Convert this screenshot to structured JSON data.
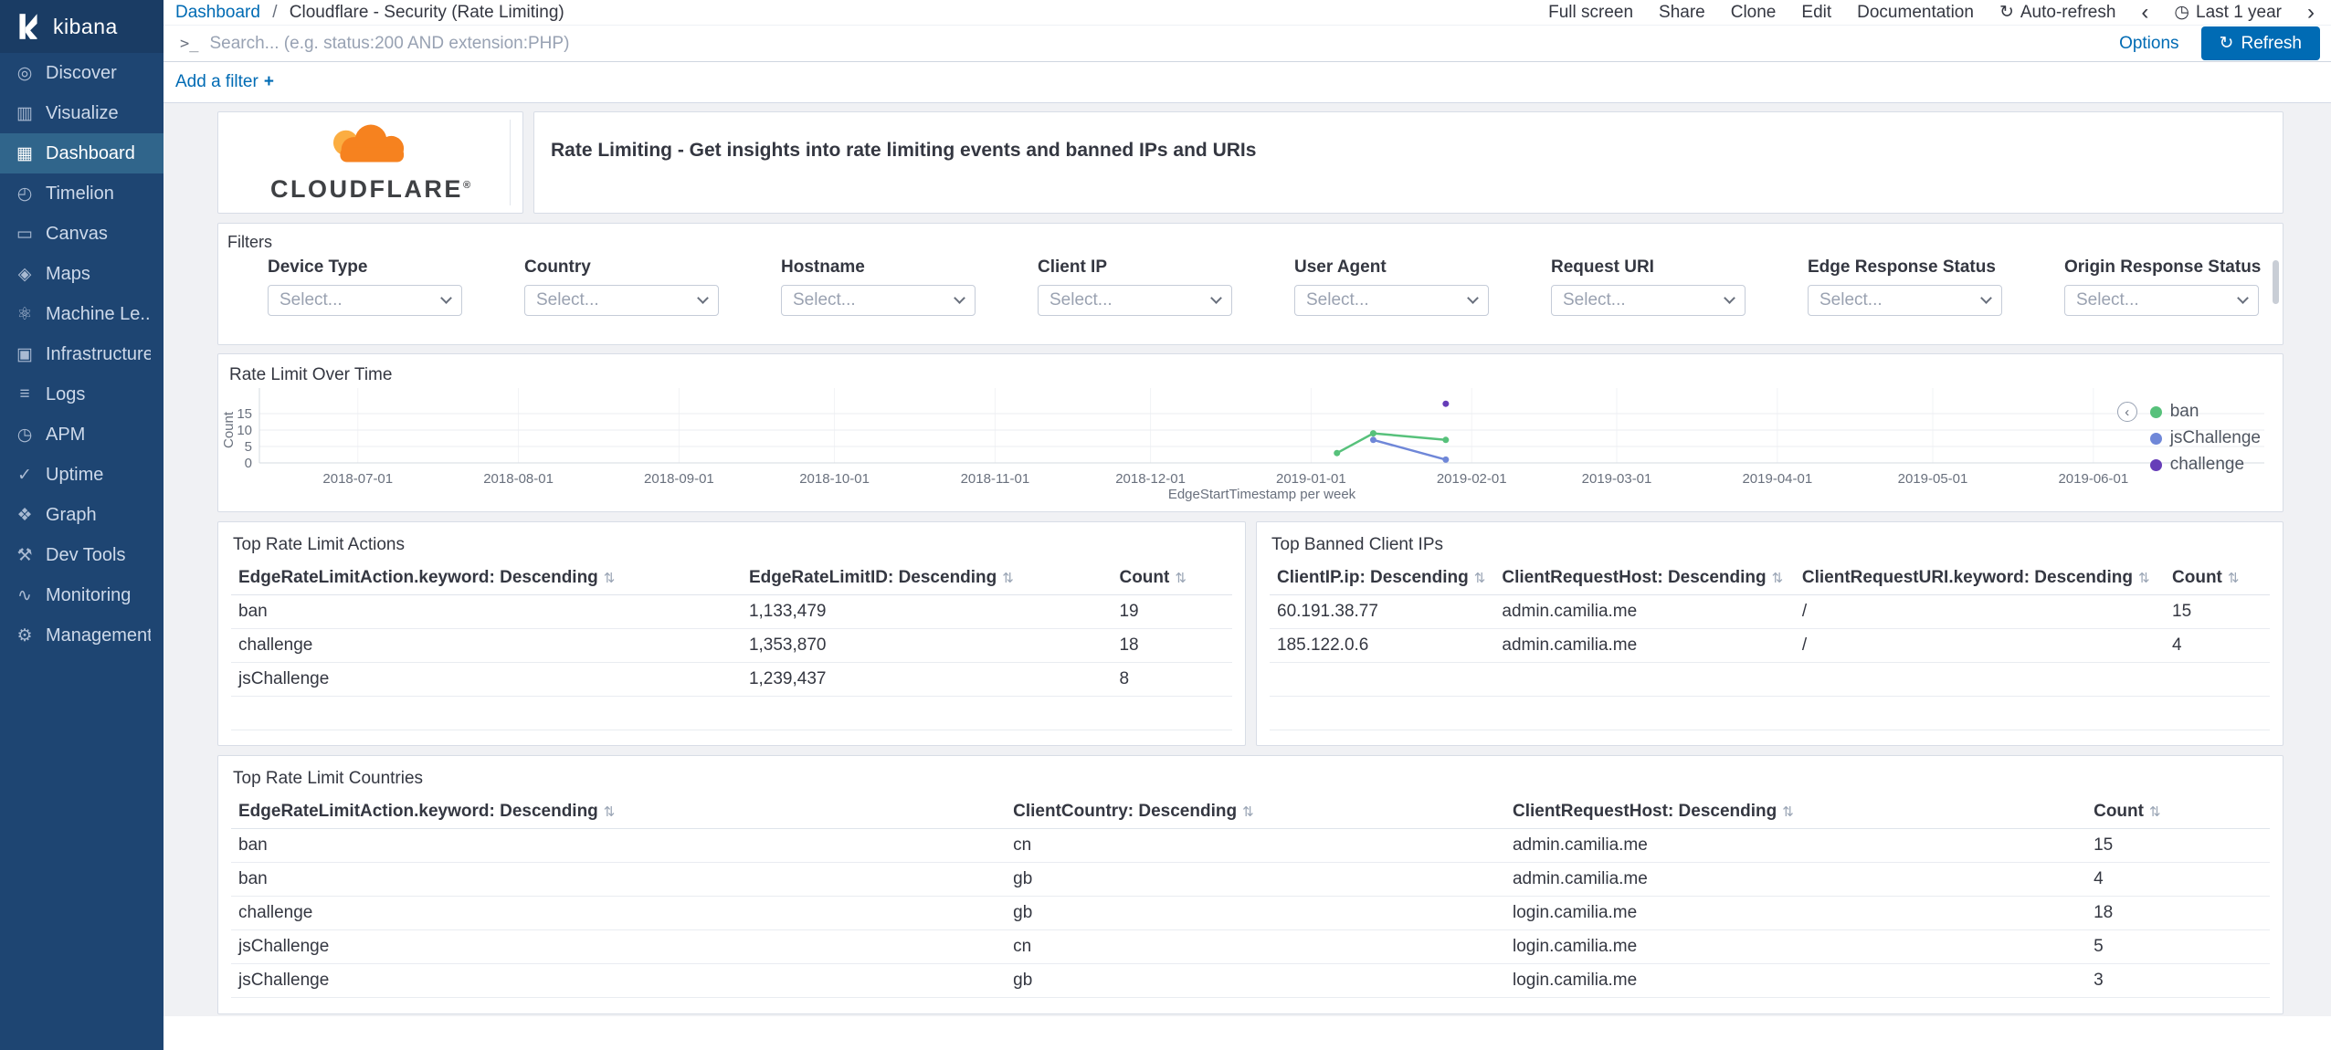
{
  "app": {
    "name": "kibana"
  },
  "glyphs": {
    "refresh": "↻",
    "clock": "◷",
    "chevron_left": "‹",
    "chevron_right": "›",
    "sort": "⇅",
    "legend_toggle": "‹"
  },
  "icon_glyphs": {
    "compass-icon": "◎",
    "bar-chart-icon": "▥",
    "dashboard-grid-icon": "▦",
    "timelion-clock-icon": "◴",
    "canvas-icon": "▭",
    "maps-icon": "◈",
    "machine-learning-icon": "⚛",
    "infrastructure-icon": "▣",
    "logs-icon": "≡",
    "apm-icon": "◷",
    "uptime-icon": "✓",
    "graph-icon": "❖",
    "dev-tools-icon": "⚒",
    "monitoring-icon": "∿",
    "management-icon": "⚙"
  },
  "sidebar": {
    "items": [
      {
        "label": "Discover",
        "icon": "compass-icon"
      },
      {
        "label": "Visualize",
        "icon": "bar-chart-icon"
      },
      {
        "label": "Dashboard",
        "icon": "dashboard-grid-icon",
        "active": true
      },
      {
        "label": "Timelion",
        "icon": "timelion-clock-icon"
      },
      {
        "label": "Canvas",
        "icon": "canvas-icon"
      },
      {
        "label": "Maps",
        "icon": "maps-icon"
      },
      {
        "label": "Machine Le...",
        "icon": "machine-learning-icon"
      },
      {
        "label": "Infrastructure",
        "icon": "infrastructure-icon"
      },
      {
        "label": "Logs",
        "icon": "logs-icon"
      },
      {
        "label": "APM",
        "icon": "apm-icon"
      },
      {
        "label": "Uptime",
        "icon": "uptime-icon"
      },
      {
        "label": "Graph",
        "icon": "graph-icon"
      },
      {
        "label": "Dev Tools",
        "icon": "dev-tools-icon"
      },
      {
        "label": "Monitoring",
        "icon": "monitoring-icon"
      },
      {
        "label": "Management",
        "icon": "management-icon"
      }
    ]
  },
  "topbar": {
    "breadcrumb": {
      "root": "Dashboard",
      "separator": "/",
      "current": "Cloudflare - Security (Rate Limiting)"
    },
    "actions": [
      "Full screen",
      "Share",
      "Clone",
      "Edit",
      "Documentation"
    ],
    "auto_refresh_label": "Auto-refresh",
    "time_range_label": "Last 1 year"
  },
  "search": {
    "prompt": ">_",
    "placeholder": "Search... (e.g. status:200 AND extension:PHP)",
    "options_label": "Options",
    "refresh_label": "Refresh"
  },
  "filter_bar": {
    "add_filter_label": "Add a filter",
    "plus": "+"
  },
  "panels": {
    "logo": {
      "brand": "CLOUDFLARE",
      "registered": "®"
    },
    "intro": {
      "text": "Rate Limiting - Get insights into rate limiting events and banned IPs and URIs"
    },
    "filters": {
      "title": "Filters",
      "fields": [
        {
          "label": "Device Type",
          "value": "Select..."
        },
        {
          "label": "Country",
          "value": "Select..."
        },
        {
          "label": "Hostname",
          "value": "Select..."
        },
        {
          "label": "Client IP",
          "value": "Select..."
        },
        {
          "label": "User Agent",
          "value": "Select..."
        },
        {
          "label": "Request URI",
          "value": "Select..."
        },
        {
          "label": "Edge Response Status",
          "value": "Select..."
        },
        {
          "label": "Origin Response Status",
          "value": "Select..."
        }
      ]
    },
    "chart_panel": {
      "title": "Rate Limit Over Time"
    },
    "actions_table": {
      "title": "Top Rate Limit Actions",
      "columns": [
        "EdgeRateLimitAction.keyword: Descending",
        "EdgeRateLimitID: Descending",
        "Count"
      ],
      "rows": [
        [
          "ban",
          "1,133,479",
          "19"
        ],
        [
          "challenge",
          "1,353,870",
          "18"
        ],
        [
          "jsChallenge",
          "1,239,437",
          "8"
        ]
      ]
    },
    "banned_ips_table": {
      "title": "Top Banned Client IPs",
      "columns": [
        "ClientIP.ip: Descending",
        "ClientRequestHost: Descending",
        "ClientRequestURI.keyword: Descending",
        "Count"
      ],
      "rows": [
        [
          "60.191.38.77",
          "admin.camilia.me",
          "/",
          "15"
        ],
        [
          "185.122.0.6",
          "admin.camilia.me",
          "/",
          "4"
        ]
      ]
    },
    "countries_table": {
      "title": "Top Rate Limit Countries",
      "columns": [
        "EdgeRateLimitAction.keyword: Descending",
        "ClientCountry: Descending",
        "ClientRequestHost: Descending",
        "Count"
      ],
      "rows": [
        [
          "ban",
          "cn",
          "admin.camilia.me",
          "15"
        ],
        [
          "ban",
          "gb",
          "admin.camilia.me",
          "4"
        ],
        [
          "challenge",
          "gb",
          "login.camilia.me",
          "18"
        ],
        [
          "jsChallenge",
          "cn",
          "login.camilia.me",
          "5"
        ],
        [
          "jsChallenge",
          "gb",
          "login.camilia.me",
          "3"
        ]
      ]
    }
  },
  "chart_data": {
    "type": "line",
    "title": "Rate Limit Over Time",
    "xlabel": "EdgeStartTimestamp per week",
    "ylabel": "Count",
    "legend_position": "right",
    "grid": true,
    "x_domain": [
      "2018-06-12",
      "2019-07-04"
    ],
    "ylim": [
      0,
      20
    ],
    "y_ticks": [
      0,
      5,
      10,
      15
    ],
    "x_ticks": [
      "2018-07-01",
      "2018-08-01",
      "2018-09-01",
      "2018-10-01",
      "2018-11-01",
      "2018-12-01",
      "2019-01-01",
      "2019-02-01",
      "2019-03-01",
      "2019-04-01",
      "2019-05-01",
      "2019-06-01"
    ],
    "series": [
      {
        "name": "ban",
        "color": "#57c17b",
        "points": [
          [
            "2019-01-06",
            3
          ],
          [
            "2019-01-13",
            9
          ],
          [
            "2019-01-27",
            7
          ]
        ]
      },
      {
        "name": "jsChallenge",
        "color": "#6f87d8",
        "points": [
          [
            "2019-01-13",
            7
          ],
          [
            "2019-01-27",
            1
          ]
        ]
      },
      {
        "name": "challenge",
        "color": "#663db8",
        "points": [
          [
            "2019-01-27",
            18
          ]
        ]
      }
    ]
  }
}
